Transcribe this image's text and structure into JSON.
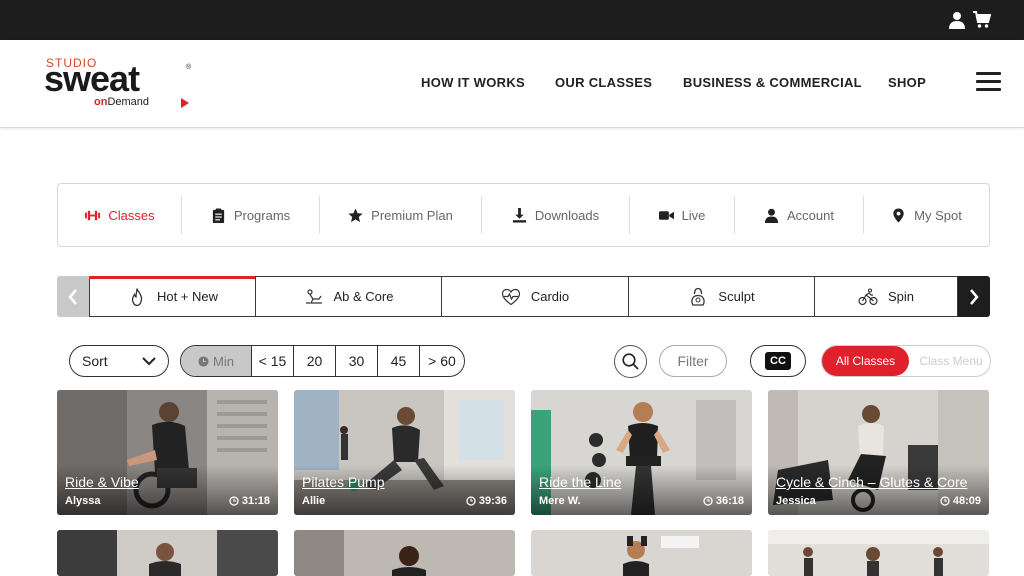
{
  "topbar": {
    "user_icon": "user-icon",
    "cart_icon": "cart-icon"
  },
  "logo": {
    "studio": "STUDIO",
    "sweat": "sweat",
    "reg": "®",
    "on": "on",
    "demand": "Demand"
  },
  "nav": {
    "items": [
      "HOW IT WORKS",
      "OUR CLASSES",
      "BUSINESS & COMMERCIAL",
      "SHOP"
    ],
    "menu_icon": "hamburger-icon"
  },
  "subnav": {
    "items": [
      {
        "label": "Classes",
        "icon": "dumbbell-icon",
        "active": true
      },
      {
        "label": "Programs",
        "icon": "clipboard-icon"
      },
      {
        "label": "Premium Plan",
        "icon": "star-icon"
      },
      {
        "label": "Downloads",
        "icon": "download-icon"
      },
      {
        "label": "Live",
        "icon": "video-icon"
      },
      {
        "label": "Account",
        "icon": "user-icon"
      },
      {
        "label": "My Spot",
        "icon": "map-pin-icon"
      }
    ]
  },
  "categories": {
    "items": [
      {
        "label": "Hot + New",
        "icon": "flame-icon",
        "active": true
      },
      {
        "label": "Ab & Core",
        "icon": "situp-icon"
      },
      {
        "label": "Cardio",
        "icon": "heart-pulse-icon"
      },
      {
        "label": "Sculpt",
        "icon": "kettlebell-icon"
      },
      {
        "label": "Spin",
        "icon": "bike-icon"
      }
    ]
  },
  "filters": {
    "sort_label": "Sort",
    "duration_label": "Min",
    "durations": [
      "< 15",
      "20",
      "30",
      "45",
      "> 60"
    ],
    "filter_label": "Filter",
    "cc_label": "CC",
    "toggle_on": "All Classes",
    "toggle_off": "Class Menu"
  },
  "classes": [
    {
      "title": "Ride & Vibe",
      "instructor": "Alyssa",
      "duration": "31:18"
    },
    {
      "title": "Pilates Pump",
      "instructor": "Allie",
      "duration": "39:36"
    },
    {
      "title": "Ride the Line",
      "instructor": "Mere W.",
      "duration": "36:18"
    },
    {
      "title": "Cycle & Cinch – Glutes & Core",
      "instructor": "Jessica",
      "duration": "48:09"
    }
  ],
  "colors": {
    "accent": "#e0202a",
    "topbar": "#1d1d1d",
    "text": "#222222"
  }
}
